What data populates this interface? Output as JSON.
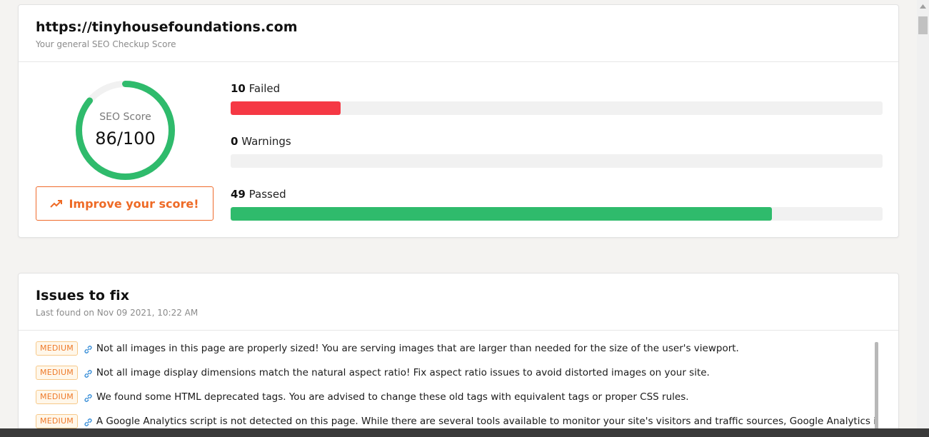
{
  "summary": {
    "site_url": "https://tinyhousefoundations.com",
    "subtitle": "Your general SEO Checkup Score",
    "score_label": "SEO Score",
    "score_value": "86/100",
    "score_fraction": 0.86,
    "improve_button": "Improve your score!",
    "metrics": [
      {
        "count": "10",
        "label": "Failed",
        "fill_fraction": 0.169,
        "color": "#f53844"
      },
      {
        "count": "0",
        "label": "Warnings",
        "fill_fraction": 0,
        "color": "#f5a623"
      },
      {
        "count": "49",
        "label": "Passed",
        "fill_fraction": 0.83,
        "color": "#2fbb6c"
      }
    ]
  },
  "issues": {
    "title": "Issues to fix",
    "subtitle": "Last found on Nov 09 2021, 10:22 AM",
    "items": [
      {
        "severity": "MEDIUM",
        "text": "Not all images in this page are properly sized! You are serving images that are larger than needed for the size of the user's viewport."
      },
      {
        "severity": "MEDIUM",
        "text": "Not all image display dimensions match the natural aspect ratio! Fix aspect ratio issues to avoid distorted images on your site."
      },
      {
        "severity": "MEDIUM",
        "text": "We found some HTML deprecated tags. You are advised to change these old tags with equivalent tags or proper CSS rules."
      },
      {
        "severity": "MEDIUM",
        "text": "A Google Analytics script is not detected on this page. While there are several tools available to monitor your site's visitors and traffic sources, Google Analytics is a"
      }
    ]
  },
  "colors": {
    "accent_orange": "#ee6a26",
    "gauge_green": "#2fbb6c",
    "gauge_track": "#f1f1f1"
  }
}
